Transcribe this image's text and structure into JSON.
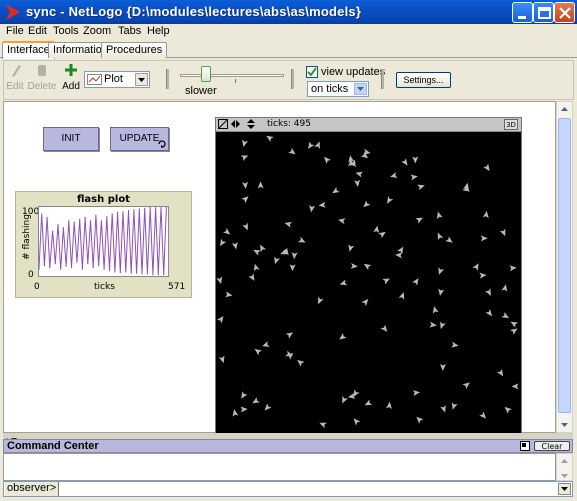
{
  "window": {
    "title": "sync - NetLogo {D:\\modules\\lectures\\abs\\as\\models}",
    "brand_color": "#e12b1b"
  },
  "menu": [
    "File",
    "Edit",
    "Tools",
    "Zoom",
    "Tabs",
    "Help"
  ],
  "tabs": [
    "Interface",
    "Information",
    "Procedures"
  ],
  "toolbar": {
    "edit_label": "Edit",
    "delete_label": "Delete",
    "add_label": "Add",
    "widget_type": "Plot",
    "speed_label": "slower",
    "view_updates_label": "view updates",
    "view_updates_checked": true,
    "update_mode": "on ticks",
    "settings_label": "Settings..."
  },
  "buttons": {
    "init_label": "INIT",
    "update_label": "UPDATE"
  },
  "plot": {
    "title": "flash plot",
    "ylabel": "# flashing",
    "xlabel": "ticks",
    "y_max": "100",
    "y_min": "0",
    "x_min": "0",
    "x_max": "571",
    "line_color": "#8e52ba"
  },
  "view": {
    "ticks_text": "ticks: 495",
    "three_d_label": "3D",
    "turtle_color": "#b9b9b9"
  },
  "command_center": {
    "title": "Command Center",
    "clear_label": "Clear",
    "observer_label": "observer>"
  },
  "chart_data": {
    "type": "line",
    "title": "flash plot",
    "xlabel": "ticks",
    "ylabel": "# flashing",
    "xlim": [
      0,
      571
    ],
    "ylim": [
      0,
      100
    ],
    "series": [
      {
        "color": "#8e52ba",
        "x": [
          0,
          12,
          24,
          36,
          48,
          60,
          72,
          84,
          96,
          108,
          120,
          132,
          144,
          156,
          168,
          180,
          192,
          204,
          216,
          228,
          240,
          252,
          264,
          276,
          288,
          300,
          312,
          324,
          336,
          348,
          360,
          372,
          384,
          396,
          408,
          420,
          432,
          444,
          456,
          468,
          480,
          492,
          504,
          516,
          528,
          540,
          552,
          564
        ],
        "y": [
          10,
          90,
          15,
          85,
          12,
          65,
          18,
          75,
          10,
          70,
          14,
          80,
          12,
          78,
          20,
          82,
          10,
          85,
          18,
          80,
          12,
          88,
          15,
          80,
          10,
          86,
          8,
          90,
          6,
          92,
          5,
          93,
          6,
          95,
          4,
          96,
          4,
          97,
          3,
          98,
          3,
          99,
          2,
          99,
          2,
          100,
          2,
          100
        ]
      }
    ]
  }
}
